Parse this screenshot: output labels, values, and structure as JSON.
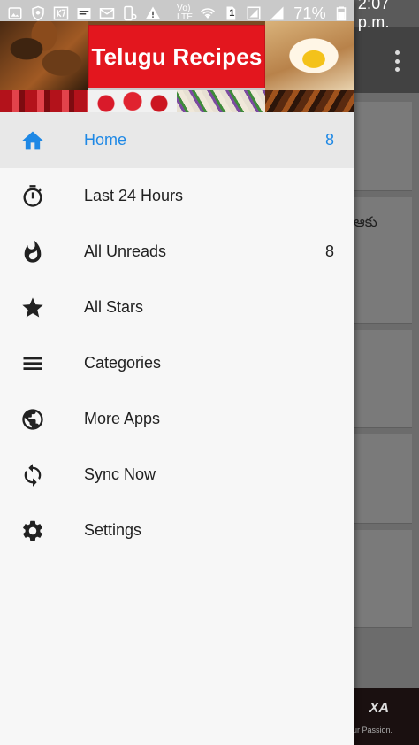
{
  "status_bar": {
    "left_icons": [
      "image-icon",
      "shield-icon",
      "k7-icon",
      "news-icon",
      "mail-icon",
      "phone-settings-icon",
      "warning-icon"
    ],
    "network_label": "Vo) LTE",
    "sim_label": "1",
    "battery_percent": "71%",
    "time": "2:07 p.m."
  },
  "header": {
    "banner_title": "Telugu Recipes",
    "banner_color": "#e3161e"
  },
  "drawer": {
    "accent_color": "#1e88e5",
    "items": [
      {
        "label": "Home",
        "icon": "home-icon",
        "count": "8",
        "active": true
      },
      {
        "label": "Last 24 Hours",
        "icon": "stopwatch-icon",
        "count": ""
      },
      {
        "label": "All Unreads",
        "icon": "flame-icon",
        "count": "8"
      },
      {
        "label": "All Stars",
        "icon": "star-icon",
        "count": ""
      },
      {
        "label": "Categories",
        "icon": "menu-icon",
        "count": ""
      },
      {
        "label": "More Apps",
        "icon": "globe-icon",
        "count": ""
      },
      {
        "label": "Sync Now",
        "icon": "sync-icon",
        "count": ""
      },
      {
        "label": "Settings",
        "icon": "gear-icon",
        "count": ""
      }
    ]
  },
  "background": {
    "snippet_text": "ఆకు",
    "ad_text": "XA",
    "ad_sub": "Our Passion."
  }
}
